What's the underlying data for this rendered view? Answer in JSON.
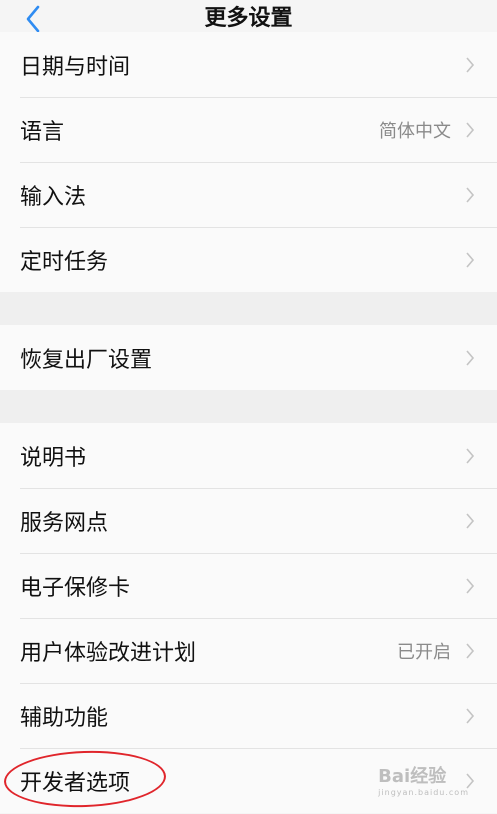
{
  "header": {
    "title": "更多设置",
    "back_icon": "chevron-left-icon",
    "accent": "#2f8cf2"
  },
  "group1": [
    {
      "label": "日期与时间",
      "value": ""
    },
    {
      "label": "语言",
      "value": "简体中文"
    },
    {
      "label": "输入法",
      "value": ""
    },
    {
      "label": "定时任务",
      "value": ""
    }
  ],
  "group2": [
    {
      "label": "恢复出厂设置",
      "value": ""
    }
  ],
  "group3": [
    {
      "label": "说明书",
      "value": ""
    },
    {
      "label": "服务网点",
      "value": ""
    },
    {
      "label": "电子保修卡",
      "value": ""
    },
    {
      "label": "用户体验改进计划",
      "value": "已开启"
    },
    {
      "label": "辅助功能",
      "value": ""
    },
    {
      "label": "开发者选项",
      "value": ""
    }
  ],
  "annotation": {
    "highlight": "开发者选项",
    "color": "#e0252b"
  },
  "watermark": {
    "text": "Bai经验",
    "sub": "jingyan.baidu.com"
  }
}
